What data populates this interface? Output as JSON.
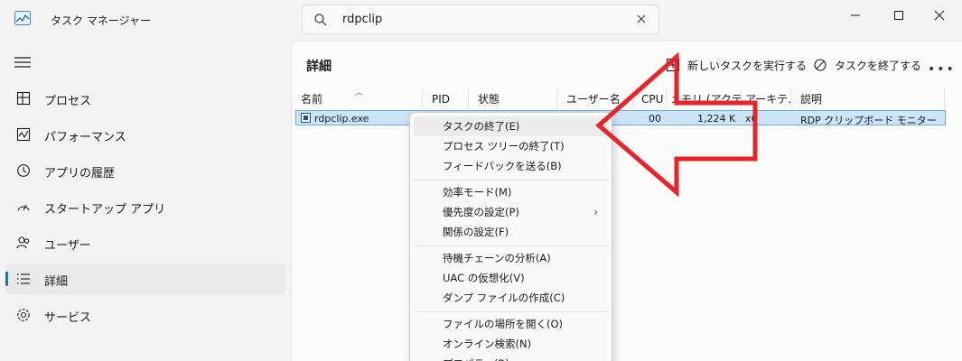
{
  "app": {
    "title": "タスク マネージャー"
  },
  "search": {
    "value": "rdpclip"
  },
  "nav": {
    "items": [
      {
        "label": "プロセス",
        "icon": "processes-icon"
      },
      {
        "label": "パフォーマンス",
        "icon": "performance-icon"
      },
      {
        "label": "アプリの履歴",
        "icon": "app-history-icon"
      },
      {
        "label": "スタートアップ アプリ",
        "icon": "startup-icon"
      },
      {
        "label": "ユーザー",
        "icon": "users-icon"
      },
      {
        "label": "詳細",
        "icon": "details-icon",
        "selected": true
      },
      {
        "label": "サービス",
        "icon": "services-icon"
      }
    ]
  },
  "main": {
    "title": "詳細",
    "commands": {
      "new_task": "新しいタスクを実行する",
      "end_task": "タスクを終了する",
      "more": "•••"
    }
  },
  "table": {
    "columns": [
      "名前",
      "PID",
      "状態",
      "ユーザー名",
      "CPU",
      "メモリ (アクテ…",
      "アーキテ…",
      "説明"
    ],
    "rows": [
      {
        "name": "rdpclip.exe",
        "cpu": "00",
        "memory": "1,224 K",
        "arch": "x6",
        "description": "RDP クリップボード モニター"
      }
    ]
  },
  "context_menu": {
    "items": [
      "タスクの終了(E)",
      "プロセス ツリーの終了(T)",
      "フィードバックを送る(B)",
      "効率モード(M)",
      "優先度の設定(P)",
      "関係の設定(F)",
      "待機チェーンの分析(A)",
      "UAC の仮想化(V)",
      "ダンプ ファイルの作成(C)",
      "ファイルの場所を開く(O)",
      "オンライン検索(N)",
      "プロパティ(R)"
    ]
  },
  "colors": {
    "accent": "#1f6fbf",
    "selection": "#cce4f7",
    "annotation_arrow": "#e8232a"
  }
}
